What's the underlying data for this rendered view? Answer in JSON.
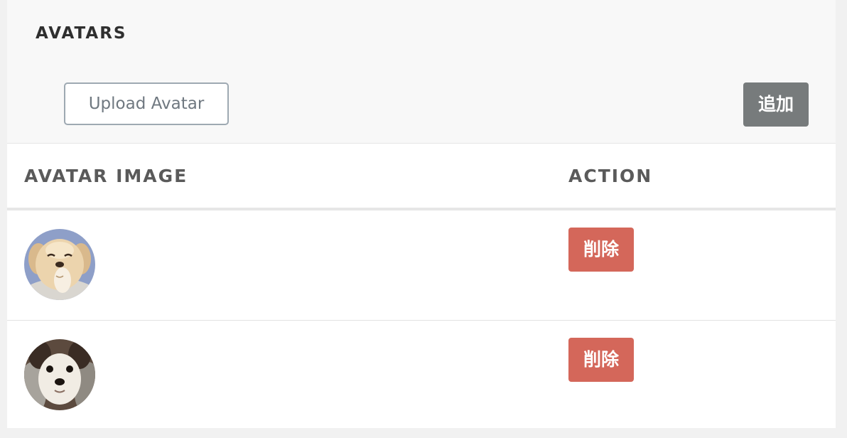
{
  "section": {
    "title": "AVATARS"
  },
  "toolbar": {
    "upload_label": "Upload Avatar",
    "add_label": "追加"
  },
  "table": {
    "columns": [
      "AVATAR IMAGE",
      "ACTION"
    ],
    "rows": [
      {
        "avatar": "puppy-laughing-avatar",
        "action_label": "削除"
      },
      {
        "avatar": "chihuahua-avatar",
        "action_label": "削除"
      }
    ]
  },
  "colors": {
    "delete": "#d4675a",
    "add": "#777b7c",
    "upload_border": "#9ea9b2"
  }
}
